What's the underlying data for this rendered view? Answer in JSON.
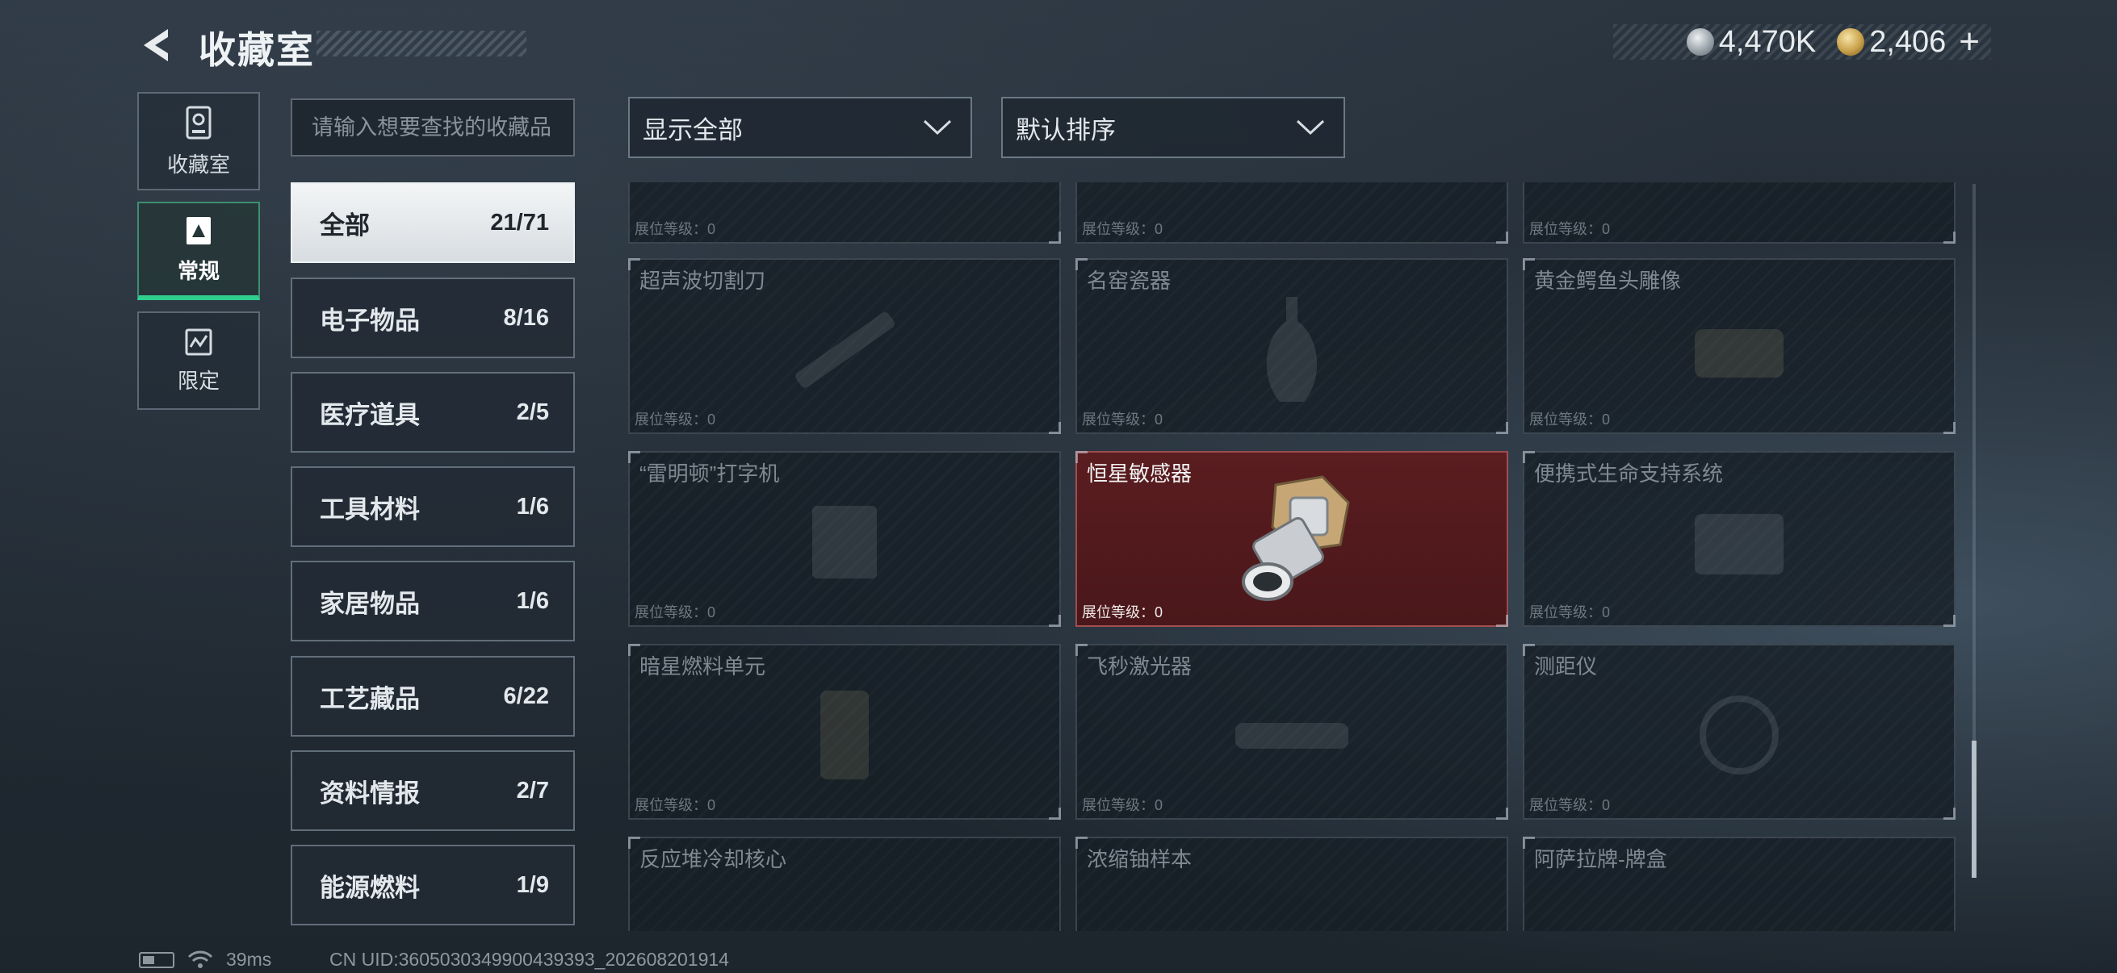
{
  "header": {
    "title": "收藏室",
    "back_icon": "back-arrow-icon",
    "currencies": [
      {
        "icon": "silver-coin-icon",
        "value": "4,470K"
      },
      {
        "icon": "gold-coin-icon",
        "value": "2,406"
      }
    ],
    "plus_label": "+"
  },
  "nav": {
    "tabs": [
      {
        "label": "收藏室",
        "icon": "trophy-icon",
        "active": false
      },
      {
        "label": "常规",
        "icon": "document-icon",
        "active": true
      },
      {
        "label": "限定",
        "icon": "limited-icon",
        "active": false
      }
    ],
    "accent_color": "#2fd08d"
  },
  "search": {
    "placeholder": "请输入想要查找的收藏品",
    "value": ""
  },
  "categories": [
    {
      "label": "全部",
      "count": "21/71",
      "active": true
    },
    {
      "label": "电子物品",
      "count": "8/16"
    },
    {
      "label": "医疗道具",
      "count": "2/5"
    },
    {
      "label": "工具材料",
      "count": "1/6"
    },
    {
      "label": "家居物品",
      "count": "1/6"
    },
    {
      "label": "工艺藏品",
      "count": "6/22"
    },
    {
      "label": "资料情报",
      "count": "2/7"
    },
    {
      "label": "能源燃料",
      "count": "1/9"
    }
  ],
  "filters": {
    "display_label": "显示全部",
    "sort_label": "默认排序",
    "chevron_icon": "chevron-down-icon"
  },
  "items": [
    {
      "name": "",
      "level": "展位等级：0"
    },
    {
      "name": "",
      "level": "展位等级：0"
    },
    {
      "name": "",
      "level": "展位等级：0"
    },
    {
      "name": "超声波切割刀",
      "level": "展位等级：0"
    },
    {
      "name": "名窑瓷器",
      "level": "展位等级：0"
    },
    {
      "name": "黄金鳄鱼头雕像",
      "level": "展位等级：0"
    },
    {
      "name": "“雷明顿”打字机",
      "level": "展位等级：0"
    },
    {
      "name": "恒星敏感器",
      "level": "展位等级：0",
      "unlocked": true
    },
    {
      "name": "便携式生命支持系统",
      "level": "展位等级：0"
    },
    {
      "name": "暗星燃料单元",
      "level": "展位等级：0"
    },
    {
      "name": "飞秒激光器",
      "level": "展位等级：0"
    },
    {
      "name": "测距仪",
      "level": "展位等级：0"
    },
    {
      "name": "反应堆冷却核心",
      "level": ""
    },
    {
      "name": "浓缩铀样本",
      "level": ""
    },
    {
      "name": "阿萨拉牌-牌盒",
      "level": ""
    }
  ],
  "footer": {
    "ping": "39ms",
    "uid": "CN UID:3605030349900439393_202608201914"
  },
  "colors": {
    "unlocked_card": "#5a1d20",
    "active_category": "#f3f5f6"
  }
}
